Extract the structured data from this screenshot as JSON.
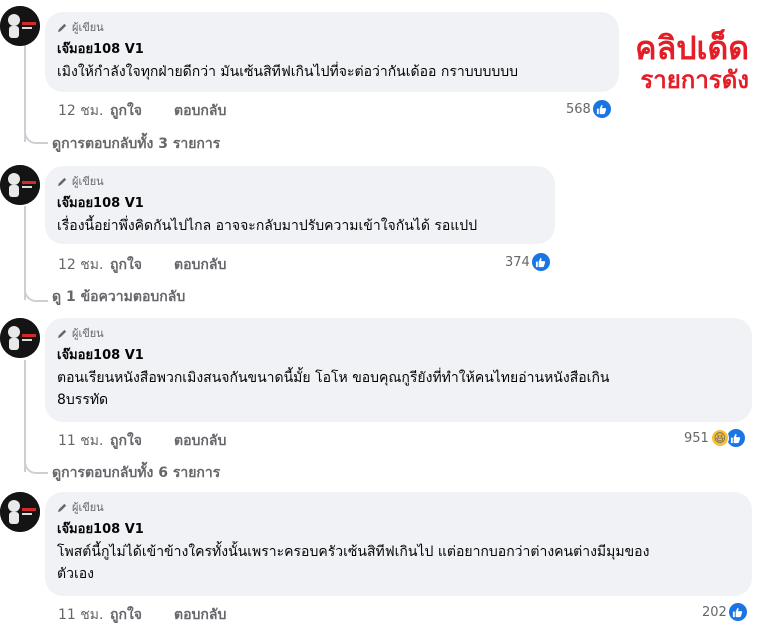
{
  "watermark": {
    "line1": "คลิปเด็ด",
    "line2": "รายการดัง"
  },
  "comments": [
    {
      "badge": "ผู้เขียน",
      "author": "เจ๊มอย108 V1",
      "text": "เมิงให้กำลังใจทุกฝ่ายดีกว่า มันเซ้นสิทีฟเกินไปที่จะต่อว่ากันเด้ออ กราบบบบบบ",
      "time": "12 ชม.",
      "like": "ถูกใจ",
      "reply": "ตอบกลับ",
      "reactions": "568",
      "view_replies": "ดูการตอบกลับทั้ง 3 รายการ"
    },
    {
      "badge": "ผู้เขียน",
      "author": "เจ๊มอย108 V1",
      "text": "เรื่องนี้อย่าพึ่งคิดกันไปไกล อาจจะกลับมาปรับความเข้าใจกันได้ รอแปป",
      "time": "12 ชม.",
      "like": "ถูกใจ",
      "reply": "ตอบกลับ",
      "reactions": "374",
      "view_replies": "ดู 1 ข้อความตอบกลับ"
    },
    {
      "badge": "ผู้เขียน",
      "author": "เจ๊มอย108 V1",
      "text_line1": "ตอนเรียนหนังสือพวกเมิงสนจกันขนาดนี้มั้ย โอโห ขอบคุณกูรียังที่ทำให้คนไทยอ่านหนังสือเกิน",
      "text_line2": "8บรรทัด",
      "time": "11 ชม.",
      "like": "ถูกใจ",
      "reply": "ตอบกลับ",
      "reactions": "951",
      "view_replies": "ดูการตอบกลับทั้ง 6 รายการ"
    },
    {
      "badge": "ผู้เขียน",
      "author": "เจ๊มอย108 V1",
      "text_line1": "โพสต์นี้กูไม่ได้เข้าข้างใครทั้งนั้นเพราะครอบครัวเซ้นสิทีฟเกินไป แต่อยากบอกว่าต่างคนต่างมีมุมของ",
      "text_line2": "ตัวเอง",
      "time": "11 ชม.",
      "like": "ถูกใจ",
      "reply": "ตอบกลับ",
      "reactions": "202"
    }
  ],
  "colors": {
    "like_blue": "#1b74e4",
    "bubble_bg": "#f0f2f5",
    "watermark_red": "#e41e26"
  }
}
